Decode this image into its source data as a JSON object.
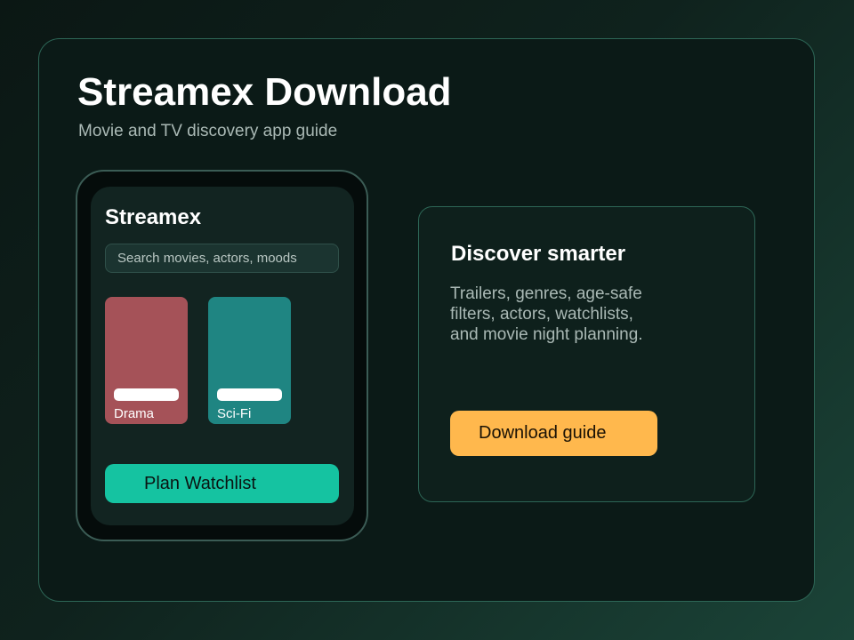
{
  "page": {
    "title": "Streamex Download",
    "subtitle": "Movie and TV discovery app guide"
  },
  "phone": {
    "app_title": "Streamex",
    "search": {
      "placeholder": "Search movies, actors, moods",
      "value": ""
    },
    "genre_cards": [
      {
        "label": "Drama",
        "color": "#a55258"
      },
      {
        "label": "Sci-Fi",
        "color": "#1f8582"
      }
    ],
    "plan_button_label": "Plan Watchlist"
  },
  "info": {
    "title": "Discover smarter",
    "body_lines": [
      "Trailers, genres, age-safe",
      "filters, actors, watchlists,",
      "and movie night planning."
    ],
    "download_button_label": "Download guide"
  },
  "colors": {
    "primary_accent": "#15c3a1",
    "cta_accent": "#ffb84d",
    "border_accent": "#2d6656",
    "panel_background": "#0b1a17"
  }
}
